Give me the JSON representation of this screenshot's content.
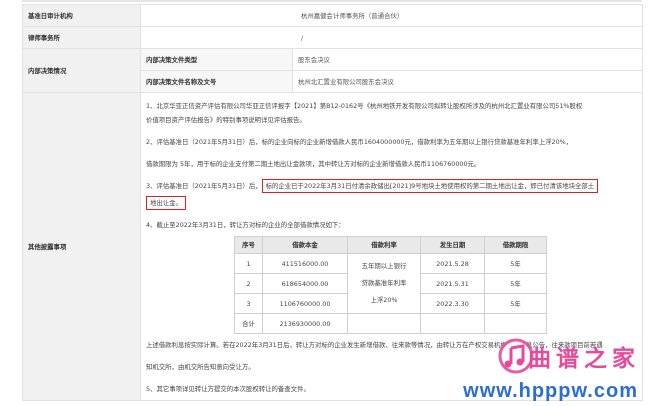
{
  "rows": {
    "audit_firm_label": "基准日审计机构",
    "audit_firm_value": "杭州嘉健会计师事务所（普通合伙）",
    "law_firm_label": "律师事务所",
    "law_firm_value": "/",
    "decision_label": "内部决策情况",
    "decision_type_label": "内部决策文件类型",
    "decision_type_value": "股东会决议",
    "decision_name_label": "内部决策文件名称及文号",
    "decision_name_value": "杭州北汇置业有限公司股东会决议",
    "other_label": "其他披露事项"
  },
  "disclosures": {
    "p1": "1、北京华亚正信资产评估有限公司华亚正信评报字【2021】第B12-0162号《杭州地铁开发有限公司拟转让股权所涉及的杭州北汇置业有限公司51%股权",
    "p1b": "价值项目资产评估报告》的特别事项说明详见评估报告。",
    "p2": "2、评估基准日（2021年5月31日）后，标的企业向标的企业新增借款人民币1604000000元，借款利率为五年期以上银行贷款基准年利率上浮20%，",
    "p2b": "借款期限为 5年，用于标的企业支付第二期土地出让金款项，其中转让方对标的企业新增借款人民币1106760000元。",
    "p3_prefix": "3、评估基准日（2021年5月31日）后，",
    "p3_boxed": "标的企业已于2022年3月31日付清余政储出[2021]9号地块土地使用权的第二期土地出让金，即已付清该地块全部土",
    "p3_boxed2": "地出让金。",
    "p4": "4、截止至2022年3月31日，转让方对标的企业的全部借款情况如下：",
    "p5": "上述借款利息按实际计算。若在2022年3月31日后，转让方对标的企业发生新增借款、往来款等情况，由转让方在产权交易机构进行信息公告，往来款项目前若遇",
    "p5b": "知机交所，由机交所告知意向受让方。",
    "p6": "5、其它事项详见转让方提交的本次股权转让的备查文件。"
  },
  "loan_table": {
    "headers": [
      "序号",
      "借款本金",
      "借款利率",
      "发生日期",
      "借款期限"
    ],
    "rows": [
      {
        "no": "1",
        "amount": "411516000.00",
        "date": "2021.5.28",
        "term": "5年"
      },
      {
        "no": "2",
        "amount": "618654000.00",
        "date": "2021.5.31",
        "term": "5年"
      },
      {
        "no": "3",
        "amount": "1106760000.00",
        "date": "2022.3.30",
        "term": "5年"
      }
    ],
    "rate_lines": [
      "五年期以上银行",
      "贷款基准年利率",
      "上浮20%"
    ],
    "total_label": "合计",
    "total_amount": "2136930000.00"
  },
  "watermark": {
    "name": "曲谱之家",
    "site": "www.hpppw.com",
    "colors": {
      "pink": "#e84a9b",
      "blue": "#2a6fd0"
    }
  }
}
